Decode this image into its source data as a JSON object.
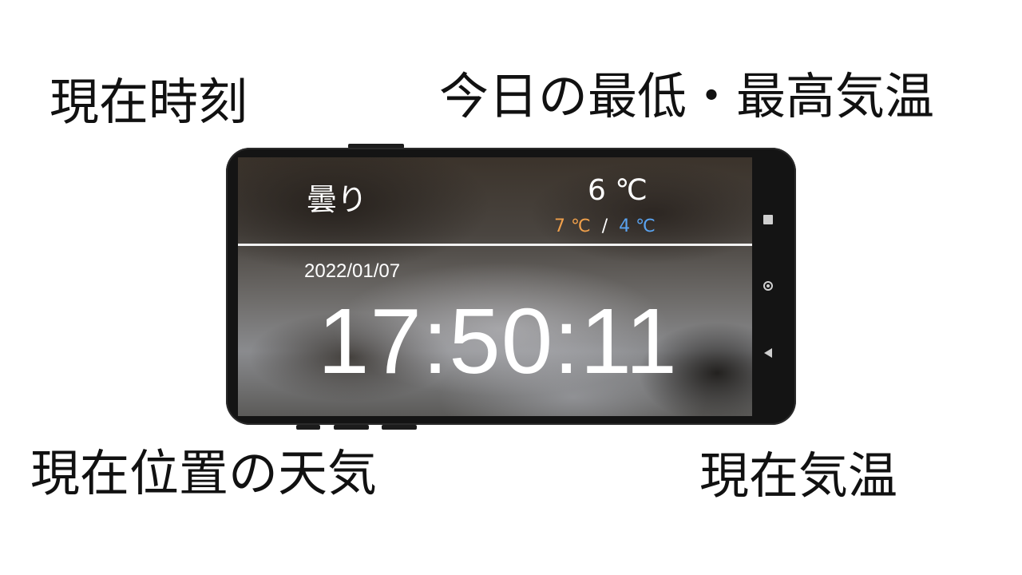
{
  "captions": {
    "current_time": "現在時刻",
    "today_min_max": "今日の最低・最高気温",
    "current_weather": "現在位置の天気",
    "current_temperature": "現在気温"
  },
  "screen": {
    "weather": "曇り",
    "current_temp": "6 ℃",
    "max_temp": "7 ℃",
    "separator": "/",
    "min_temp": "4 ℃",
    "date": "2022/01/07",
    "time": "17:50:11"
  },
  "nav_icons": [
    "square-icon",
    "circle-icon",
    "back-triangle-icon"
  ],
  "colors": {
    "max_temp": "#f0a04b",
    "min_temp": "#5aa3f0",
    "text": "#ffffff",
    "phone_body": "#141414"
  }
}
